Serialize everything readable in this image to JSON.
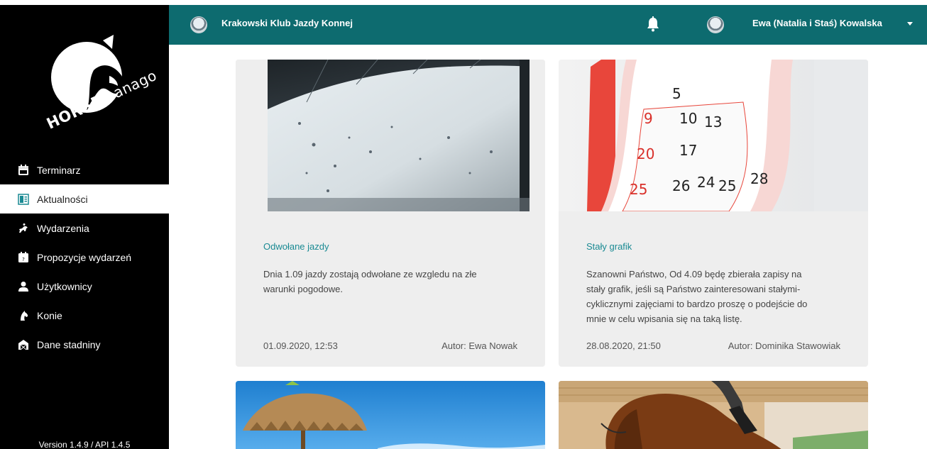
{
  "app": {
    "brand": "HORSEmanago",
    "version": "Version 1.4.9 / API 1.4.5"
  },
  "topbar": {
    "club_name": "Krakowski Klub Jazdy Konnej",
    "user_name": "Ewa (Natalia i Staś) Kowalska"
  },
  "sidebar": {
    "items": [
      {
        "label": "Terminarz",
        "icon": "calendar-icon"
      },
      {
        "label": "Aktualności",
        "icon": "news-icon",
        "active": true
      },
      {
        "label": "Wydarzenia",
        "icon": "rider-icon"
      },
      {
        "label": "Propozycje wydarzeń",
        "icon": "calendar-question-icon"
      },
      {
        "label": "Użytkownicy",
        "icon": "user-icon"
      },
      {
        "label": "Konie",
        "icon": "horse-head-icon"
      },
      {
        "label": "Dane stadniny",
        "icon": "stable-icon"
      }
    ]
  },
  "news": [
    {
      "title": "Odwołane jazdy",
      "body": "Dnia 1.09 jazdy zostają odwołane ze wzgledu na złe warunki pogodowe.",
      "date": "01.09.2020, 12:53",
      "author": "Autor: Ewa Nowak",
      "image": "umbrella-rain-photo"
    },
    {
      "title": "Stały grafik",
      "body": "Szanowni Państwo, Od 4.09 będę zbierała zapisy na stały grafik, jeśli są Państwo zainteresowani stałymi-cyklicznymi zajęciami to bardzo proszę o podejście do mnie w celu wpisania się na taką listę.",
      "date": "28.08.2020, 21:50",
      "author": "Autor: Dominika Stawowiak",
      "image": "calendar-photo"
    },
    {
      "image": "beach-umbrella-photo"
    },
    {
      "image": "horse-jumping-photo"
    }
  ],
  "colors": {
    "topbar": "#0d6b6f",
    "sidebar": "#000000",
    "accent_title": "#1a8a93",
    "card_bg": "#eeeeee"
  }
}
